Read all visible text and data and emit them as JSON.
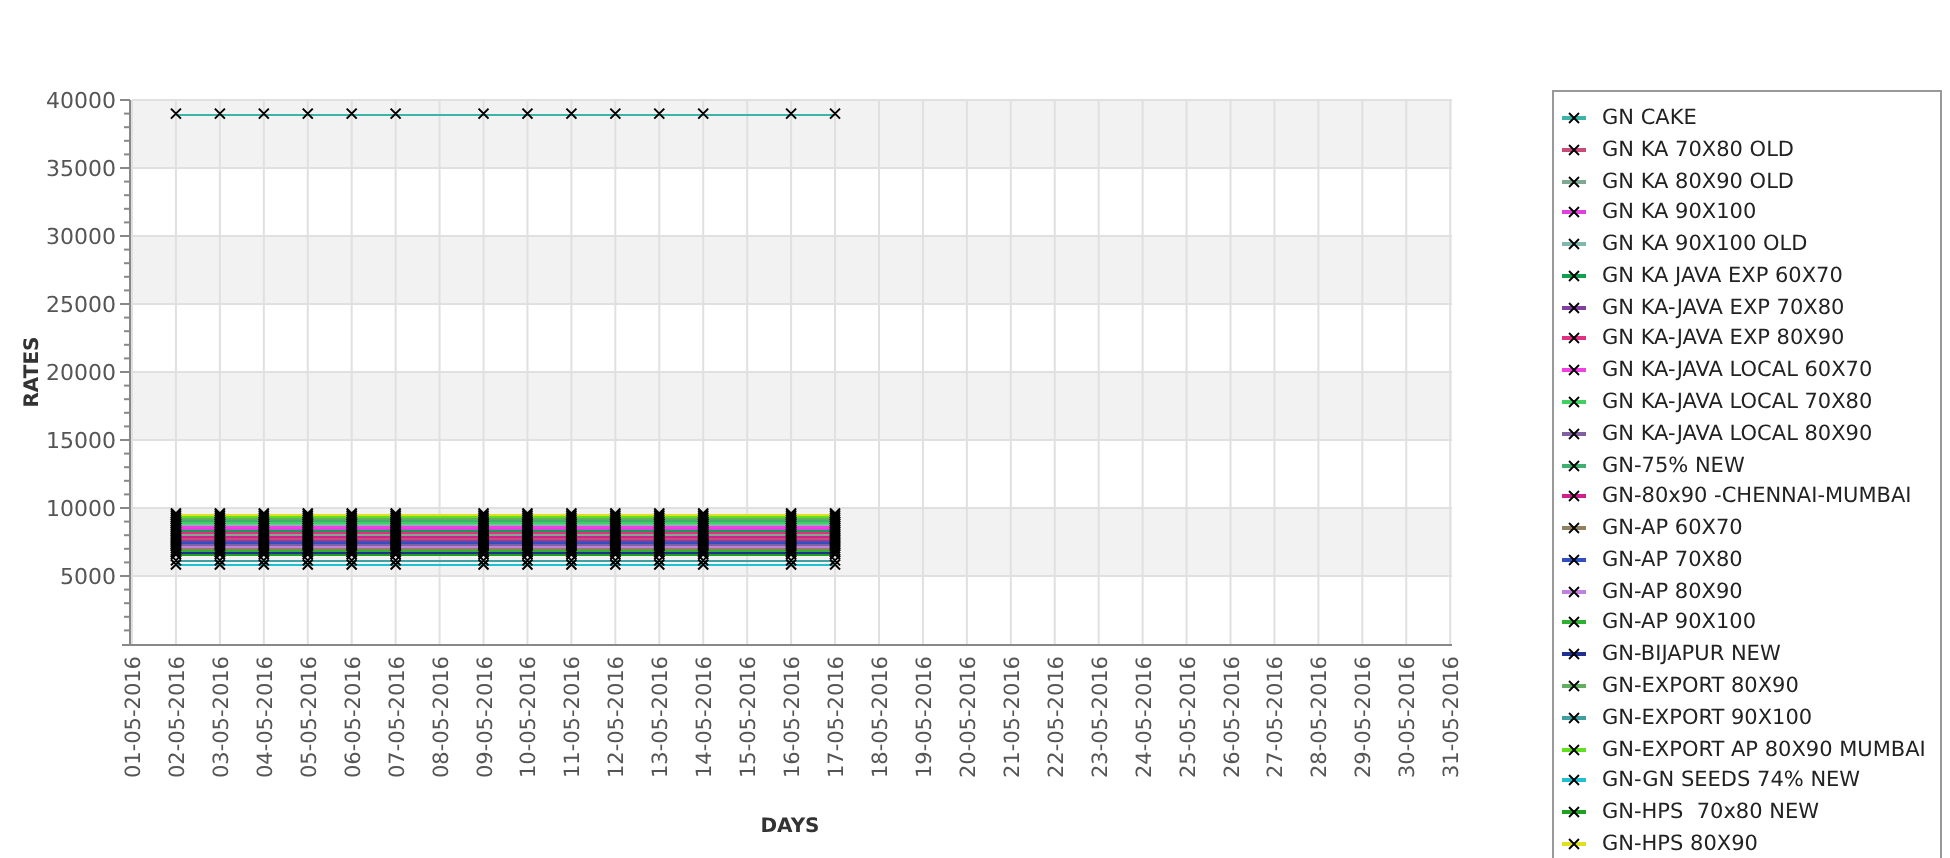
{
  "chart_data": {
    "type": "line",
    "xlabel": "DAYS",
    "ylabel": "RATES",
    "grid": true,
    "categories": [
      "01-05-2016",
      "02-05-2016",
      "03-05-2016",
      "04-05-2016",
      "05-05-2016",
      "06-05-2016",
      "07-05-2016",
      "08-05-2016",
      "09-05-2016",
      "10-05-2016",
      "11-05-2016",
      "12-05-2016",
      "13-05-2016",
      "14-05-2016",
      "15-05-2016",
      "16-05-2016",
      "17-05-2016",
      "18-05-2016",
      "19-05-2016",
      "20-05-2016",
      "21-05-2016",
      "22-05-2016",
      "23-05-2016",
      "24-05-2016",
      "25-05-2016",
      "26-05-2016",
      "27-05-2016",
      "28-05-2016",
      "29-05-2016",
      "30-05-2016",
      "31-05-2016"
    ],
    "ylim": [
      0,
      40000
    ],
    "yticks": [
      5000,
      10000,
      15000,
      20000,
      25000,
      30000,
      35000,
      40000
    ],
    "series": [
      {
        "name": "GN CAKE",
        "color": "#3cb4a8",
        "marker": "x",
        "values": [
          null,
          39000,
          39000,
          39000,
          39000,
          39000,
          39000,
          null,
          39000,
          39000,
          39000,
          39000,
          39000,
          39000,
          null,
          39000,
          39000,
          null,
          null,
          null,
          null,
          null,
          null,
          null,
          null,
          null,
          null,
          null,
          null,
          null,
          null
        ]
      },
      {
        "name": "GN KA 70X80 OLD",
        "color": "#c84b7a",
        "marker": "x",
        "values": [
          null,
          7800,
          7800,
          7800,
          7800,
          7800,
          7800,
          null,
          7800,
          7800,
          7800,
          7800,
          7800,
          7800,
          null,
          7800,
          7800,
          null,
          null,
          null,
          null,
          null,
          null,
          null,
          null,
          null,
          null,
          null,
          null,
          null,
          null
        ]
      },
      {
        "name": "GN KA 80X90 OLD",
        "color": "#7fa890",
        "marker": "x",
        "values": [
          null,
          8100,
          8100,
          8100,
          8100,
          8100,
          8100,
          null,
          8100,
          8100,
          8100,
          8100,
          8100,
          8100,
          null,
          8100,
          8100,
          null,
          null,
          null,
          null,
          null,
          null,
          null,
          null,
          null,
          null,
          null,
          null,
          null,
          null
        ]
      },
      {
        "name": "GN KA 90X100",
        "color": "#e040e0",
        "marker": "x",
        "values": [
          null,
          8550,
          8550,
          8550,
          8550,
          8550,
          8550,
          null,
          8550,
          8550,
          8550,
          8550,
          8550,
          8550,
          null,
          8550,
          8550,
          null,
          null,
          null,
          null,
          null,
          null,
          null,
          null,
          null,
          null,
          null,
          null,
          null,
          null
        ]
      },
      {
        "name": "GN KA 90X100 OLD",
        "color": "#80b8b0",
        "marker": "x",
        "values": [
          null,
          8850,
          8850,
          8850,
          8850,
          8850,
          8850,
          null,
          8850,
          8850,
          8850,
          8850,
          8850,
          8850,
          null,
          8850,
          8850,
          null,
          null,
          null,
          null,
          null,
          null,
          null,
          null,
          null,
          null,
          null,
          null,
          null,
          null
        ]
      },
      {
        "name": "GN KA JAVA EXP 60X70",
        "color": "#10a050",
        "marker": "x",
        "values": [
          null,
          8400,
          8400,
          8400,
          8400,
          8400,
          8400,
          null,
          8400,
          8400,
          8400,
          8400,
          8400,
          8400,
          null,
          8400,
          8400,
          null,
          null,
          null,
          null,
          null,
          null,
          null,
          null,
          null,
          null,
          null,
          null,
          null,
          null
        ]
      },
      {
        "name": "GN KA-JAVA EXP 70X80",
        "color": "#8040a0",
        "marker": "x",
        "values": [
          null,
          7650,
          7650,
          7650,
          7650,
          7650,
          7650,
          null,
          7650,
          7650,
          7650,
          7650,
          7650,
          7650,
          null,
          7650,
          7650,
          null,
          null,
          null,
          null,
          null,
          null,
          null,
          null,
          null,
          null,
          null,
          null,
          null,
          null
        ]
      },
      {
        "name": "GN KA-JAVA EXP 80X90",
        "color": "#e03080",
        "marker": "x",
        "values": [
          null,
          8250,
          8250,
          8250,
          8250,
          8250,
          8250,
          null,
          8250,
          8250,
          8250,
          8250,
          8250,
          8250,
          null,
          8250,
          8250,
          null,
          null,
          null,
          null,
          null,
          null,
          null,
          null,
          null,
          null,
          null,
          null,
          null,
          null
        ]
      },
      {
        "name": "GN KA-JAVA LOCAL 60X70",
        "color": "#f040e0",
        "marker": "x",
        "values": [
          null,
          8700,
          8700,
          8700,
          8700,
          8700,
          8700,
          null,
          8700,
          8700,
          8700,
          8700,
          8700,
          8700,
          null,
          8700,
          8700,
          null,
          null,
          null,
          null,
          null,
          null,
          null,
          null,
          null,
          null,
          null,
          null,
          null,
          null
        ]
      },
      {
        "name": "GN KA-JAVA LOCAL 70X80",
        "color": "#40d060",
        "marker": "x",
        "values": [
          null,
          9000,
          9000,
          9000,
          9000,
          9000,
          9000,
          null,
          9000,
          9000,
          9000,
          9000,
          9000,
          9000,
          null,
          9000,
          9000,
          null,
          null,
          null,
          null,
          null,
          null,
          null,
          null,
          null,
          null,
          null,
          null,
          null,
          null
        ]
      },
      {
        "name": "GN KA-JAVA LOCAL 80X90",
        "color": "#8060a0",
        "marker": "x",
        "values": [
          null,
          7350,
          7350,
          7350,
          7350,
          7350,
          7350,
          null,
          7350,
          7350,
          7350,
          7350,
          7350,
          7350,
          null,
          7350,
          7350,
          null,
          null,
          null,
          null,
          null,
          null,
          null,
          null,
          null,
          null,
          null,
          null,
          null,
          null
        ]
      },
      {
        "name": "GN-75% NEW",
        "color": "#40b070",
        "marker": "x",
        "values": [
          null,
          9150,
          9150,
          9150,
          9150,
          9150,
          9150,
          null,
          9150,
          9150,
          9150,
          9150,
          9150,
          9150,
          null,
          9150,
          9150,
          null,
          null,
          null,
          null,
          null,
          null,
          null,
          null,
          null,
          null,
          null,
          null,
          null,
          null
        ]
      },
      {
        "name": "GN-80x90 -CHENNAI-MUMBAI",
        "color": "#d02090",
        "marker": "x",
        "values": [
          null,
          7950,
          7950,
          7950,
          7950,
          7950,
          7950,
          null,
          7950,
          7950,
          7950,
          7950,
          7950,
          7950,
          null,
          7950,
          7950,
          null,
          null,
          null,
          null,
          null,
          null,
          null,
          null,
          null,
          null,
          null,
          null,
          null,
          null
        ]
      },
      {
        "name": "GN-AP 60X70",
        "color": "#908060",
        "marker": "x",
        "values": [
          null,
          7050,
          7050,
          7050,
          7050,
          7050,
          7050,
          null,
          7050,
          7050,
          7050,
          7050,
          7050,
          7050,
          null,
          7050,
          7050,
          null,
          null,
          null,
          null,
          null,
          null,
          null,
          null,
          null,
          null,
          null,
          null,
          null,
          null
        ]
      },
      {
        "name": "GN-AP 70X80",
        "color": "#3050c0",
        "marker": "x",
        "values": [
          null,
          7500,
          7500,
          7500,
          7500,
          7500,
          7500,
          null,
          7500,
          7500,
          7500,
          7500,
          7500,
          7500,
          null,
          7500,
          7500,
          null,
          null,
          null,
          null,
          null,
          null,
          null,
          null,
          null,
          null,
          null,
          null,
          null,
          null
        ]
      },
      {
        "name": "GN-AP 80X90",
        "color": "#c080e0",
        "marker": "x",
        "values": [
          null,
          7200,
          7200,
          7200,
          7200,
          7200,
          7200,
          null,
          7200,
          7200,
          7200,
          7200,
          7200,
          7200,
          null,
          7200,
          7200,
          null,
          null,
          null,
          null,
          null,
          null,
          null,
          null,
          null,
          null,
          null,
          null,
          null,
          null
        ]
      },
      {
        "name": "GN-AP 90X100",
        "color": "#30b030",
        "marker": "x",
        "values": [
          null,
          6900,
          6900,
          6900,
          6900,
          6900,
          6900,
          null,
          6900,
          6900,
          6900,
          6900,
          6900,
          6900,
          null,
          6900,
          6900,
          null,
          null,
          null,
          null,
          null,
          null,
          null,
          null,
          null,
          null,
          null,
          null,
          null,
          null
        ]
      },
      {
        "name": "GN-BIJAPUR NEW",
        "color": "#203090",
        "marker": "x",
        "values": [
          null,
          6750,
          6750,
          6750,
          6750,
          6750,
          6750,
          null,
          6750,
          6750,
          6750,
          6750,
          6750,
          6750,
          null,
          6750,
          6750,
          null,
          null,
          null,
          null,
          null,
          null,
          null,
          null,
          null,
          null,
          null,
          null,
          null,
          null
        ]
      },
      {
        "name": "GN-EXPORT 80X90",
        "color": "#60b060",
        "marker": "x",
        "values": [
          null,
          9300,
          9300,
          9300,
          9300,
          9300,
          9300,
          null,
          9300,
          9300,
          9300,
          9300,
          9300,
          9300,
          null,
          9300,
          9300,
          null,
          null,
          null,
          null,
          null,
          null,
          null,
          null,
          null,
          null,
          null,
          null,
          null,
          null
        ]
      },
      {
        "name": "GN-EXPORT 90X100",
        "color": "#40a0a0",
        "marker": "x",
        "values": [
          null,
          6150,
          6150,
          6150,
          6150,
          6150,
          6150,
          null,
          6150,
          6150,
          6150,
          6150,
          6150,
          6150,
          null,
          6150,
          6150,
          null,
          null,
          null,
          null,
          null,
          null,
          null,
          null,
          null,
          null,
          null,
          null,
          null,
          null
        ]
      },
      {
        "name": "GN-EXPORT AP 80X90 MUMBAI",
        "color": "#60e020",
        "marker": "x",
        "values": [
          null,
          9450,
          9450,
          9450,
          9450,
          9450,
          9450,
          null,
          9450,
          9450,
          9450,
          9450,
          9450,
          9450,
          null,
          9450,
          9450,
          null,
          null,
          null,
          null,
          null,
          null,
          null,
          null,
          null,
          null,
          null,
          null,
          null,
          null
        ]
      },
      {
        "name": "GN-GN SEEDS 74% NEW",
        "color": "#20c0d0",
        "marker": "x",
        "values": [
          null,
          5850,
          5850,
          5850,
          5850,
          5850,
          5850,
          null,
          5850,
          5850,
          5850,
          5850,
          5850,
          5850,
          null,
          5850,
          5850,
          null,
          null,
          null,
          null,
          null,
          null,
          null,
          null,
          null,
          null,
          null,
          null,
          null,
          null
        ]
      },
      {
        "name": "GN-HPS  70x80 NEW",
        "color": "#20a020",
        "marker": "x",
        "values": [
          null,
          6600,
          6600,
          6600,
          6600,
          6600,
          6600,
          null,
          6600,
          6600,
          6600,
          6600,
          6600,
          6600,
          null,
          6600,
          6600,
          null,
          null,
          null,
          null,
          null,
          null,
          null,
          null,
          null,
          null,
          null,
          null,
          null,
          null
        ]
      },
      {
        "name": "GN-HPS 80X90",
        "color": "#e0e020",
        "marker": "x",
        "values": [
          null,
          9600,
          9600,
          9600,
          9600,
          9600,
          9600,
          null,
          9600,
          9600,
          9600,
          9600,
          9600,
          9600,
          null,
          9600,
          9600,
          null,
          null,
          null,
          null,
          null,
          null,
          null,
          null,
          null,
          null,
          null,
          null,
          null,
          null
        ]
      }
    ]
  }
}
